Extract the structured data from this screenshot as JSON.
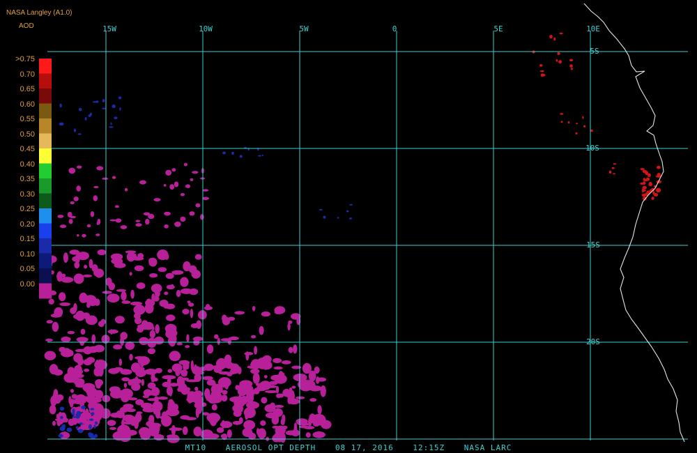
{
  "header": {
    "source": "NASA Langley (A1.0)",
    "variable": "AOD"
  },
  "map": {
    "lon_labels": [
      "15W",
      "10W",
      "5W",
      "0",
      "5E",
      "10E"
    ],
    "lat_labels": [
      "5S",
      "10S",
      "15S",
      "20S"
    ],
    "colors": {
      "grid": "#3fd0d0",
      "coast": "#e6e6e6"
    }
  },
  "colorbar": {
    "labels": [
      ">0.75",
      "0.70",
      "0.65",
      "0.60",
      "0.55",
      "0.50",
      "0.45",
      "0.40",
      "0.35",
      "0.30",
      "0.25",
      "0.20",
      "0.15",
      "0.10",
      "0.05",
      "0.00"
    ],
    "colors": [
      "#ff1a1a",
      "#b80d0d",
      "#7a0a0a",
      "#7a5a10",
      "#b8862a",
      "#e6b85c",
      "#ffff33",
      "#22cc33",
      "#1a9a2a",
      "#0d5a1a",
      "#1f8fee",
      "#1a40ee",
      "#1a2aaa",
      "#0d1a7a",
      "#0a1050",
      "#b8209a"
    ]
  },
  "footer": {
    "product": "MT10",
    "field": "AEROSOL OPT DEPTH",
    "date": "08 17, 2016",
    "time": "12:15Z",
    "org": "NASA LARC"
  }
}
